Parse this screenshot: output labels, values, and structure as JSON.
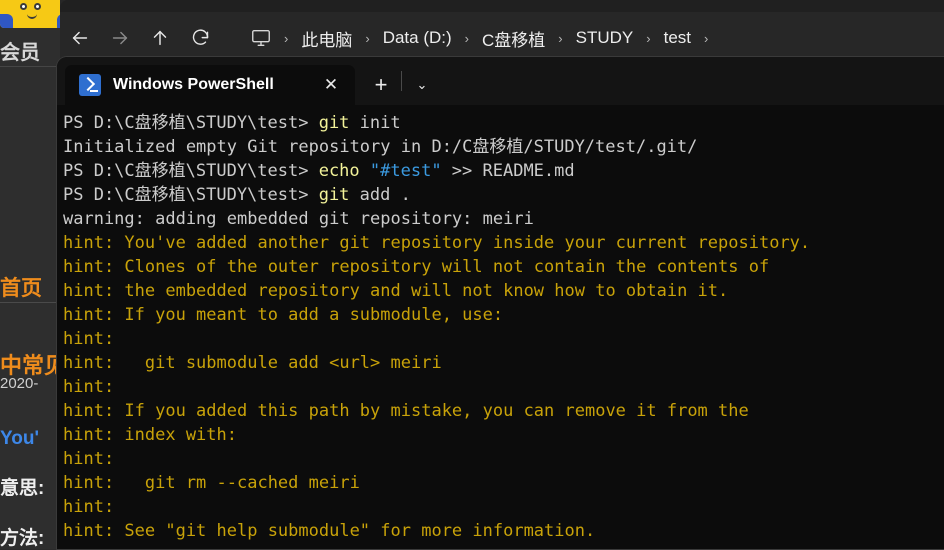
{
  "background_page": {
    "avatar_icon": "cartoon-avatar-icon",
    "vip_label": "会员",
    "home_label": "首页",
    "article_heading": "中常见",
    "article_date": "2020-",
    "quote_en": "You'",
    "meaning_label": "意思:",
    "method_label": "方法:"
  },
  "explorer": {
    "nav": {
      "back": "back-arrow",
      "forward": "forward-arrow",
      "up": "up-arrow",
      "refresh": "refresh-arrow"
    },
    "address": {
      "pc_icon": "this-pc-icon",
      "separator": "›",
      "crumbs": [
        "此电脑",
        "Data (D:)",
        "C盘移植",
        "STUDY",
        "test"
      ]
    }
  },
  "terminal": {
    "tab": {
      "icon": "powershell-icon",
      "title": "Windows PowerShell",
      "close_label": "✕",
      "new_tab_label": "+",
      "dropdown_label": "⌄"
    },
    "colors": {
      "background": "#0c0c0c",
      "default_text": "#cccccc",
      "command": "#f3f39a",
      "string": "#3b9ae0",
      "hint": "#c8a209"
    },
    "lines": [
      [
        {
          "t": "PS D:\\C盘移植\\STUDY\\test> ",
          "c": "default"
        },
        {
          "t": "git",
          "c": "cmd"
        },
        {
          "t": " init",
          "c": "default"
        }
      ],
      [
        {
          "t": "Initialized empty Git repository in D:/C盘移植/STUDY/test/.git/",
          "c": "default"
        }
      ],
      [
        {
          "t": "PS D:\\C盘移植\\STUDY\\test> ",
          "c": "default"
        },
        {
          "t": "echo",
          "c": "cmd"
        },
        {
          "t": " ",
          "c": "default"
        },
        {
          "t": "\"#test\"",
          "c": "string"
        },
        {
          "t": " >> README.md",
          "c": "default"
        }
      ],
      [
        {
          "t": "PS D:\\C盘移植\\STUDY\\test> ",
          "c": "default"
        },
        {
          "t": "git",
          "c": "cmd"
        },
        {
          "t": " add .",
          "c": "default"
        }
      ],
      [
        {
          "t": "warning: adding embedded git repository: meiri",
          "c": "default"
        }
      ],
      [
        {
          "t": "hint: You've added another git repository inside your current repository.",
          "c": "hint"
        }
      ],
      [
        {
          "t": "hint: Clones of the outer repository will not contain the contents of",
          "c": "hint"
        }
      ],
      [
        {
          "t": "hint: the embedded repository and will not know how to obtain it.",
          "c": "hint"
        }
      ],
      [
        {
          "t": "hint: If you meant to add a submodule, use:",
          "c": "hint"
        }
      ],
      [
        {
          "t": "hint:",
          "c": "hint"
        }
      ],
      [
        {
          "t": "hint:   git submodule add <url> meiri",
          "c": "hint"
        }
      ],
      [
        {
          "t": "hint:",
          "c": "hint"
        }
      ],
      [
        {
          "t": "hint: If you added this path by mistake, you can remove it from the",
          "c": "hint"
        }
      ],
      [
        {
          "t": "hint: index with:",
          "c": "hint"
        }
      ],
      [
        {
          "t": "hint:",
          "c": "hint"
        }
      ],
      [
        {
          "t": "hint:   git rm --cached meiri",
          "c": "hint"
        }
      ],
      [
        {
          "t": "hint:",
          "c": "hint"
        }
      ],
      [
        {
          "t": "hint: See \"git help submodule\" for more information.",
          "c": "hint"
        }
      ]
    ]
  }
}
